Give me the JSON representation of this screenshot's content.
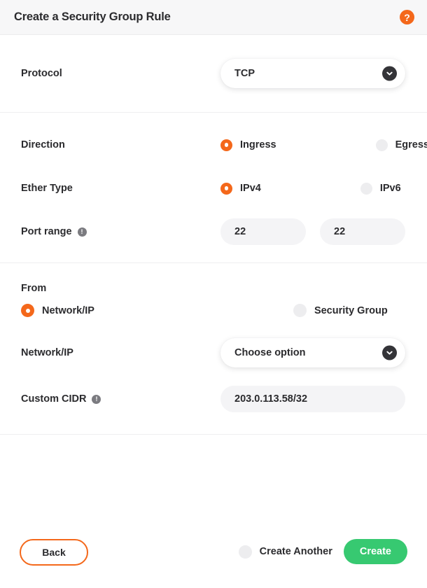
{
  "header": {
    "title": "Create a Security Group Rule",
    "help_icon": "help-circle-icon",
    "help_glyph": "?"
  },
  "theme": {
    "accent_orange": "#f4681b",
    "create_green": "#37c971",
    "text_dark": "#2b2b2e",
    "input_gray": "#f4f4f6",
    "radio_unselected": "#ededef",
    "divider": "#eeeef0",
    "header_bg": "#f7f7f8"
  },
  "protocol": {
    "label": "Protocol",
    "value": "TCP",
    "chevron_icon": "chevron-down-icon"
  },
  "direction": {
    "label": "Direction",
    "options": [
      {
        "label": "Ingress",
        "selected": true
      },
      {
        "label": "Egress",
        "selected": false
      }
    ]
  },
  "ether_type": {
    "label": "Ether Type",
    "options": [
      {
        "label": "IPv4",
        "selected": true
      },
      {
        "label": "IPv6",
        "selected": false
      }
    ]
  },
  "port_range": {
    "label": "Port range",
    "info_icon": "info-icon",
    "info_glyph": "!",
    "from_value": "22",
    "to_value": "22",
    "from_placeholder": "",
    "to_placeholder": ""
  },
  "from": {
    "title": "From",
    "options": [
      {
        "label": "Network/IP",
        "selected": true
      },
      {
        "label": "Security Group",
        "selected": false
      }
    ]
  },
  "network_ip": {
    "label": "Network/IP",
    "value": "Choose option",
    "chevron_icon": "chevron-down-icon"
  },
  "custom_cidr": {
    "label": "Custom CIDR",
    "info_icon": "info-icon",
    "info_glyph": "!",
    "value": "203.0.113.58/32",
    "placeholder": ""
  },
  "footer": {
    "back_label": "Back",
    "create_another_label": "Create Another",
    "create_another_selected": false,
    "create_label": "Create"
  }
}
